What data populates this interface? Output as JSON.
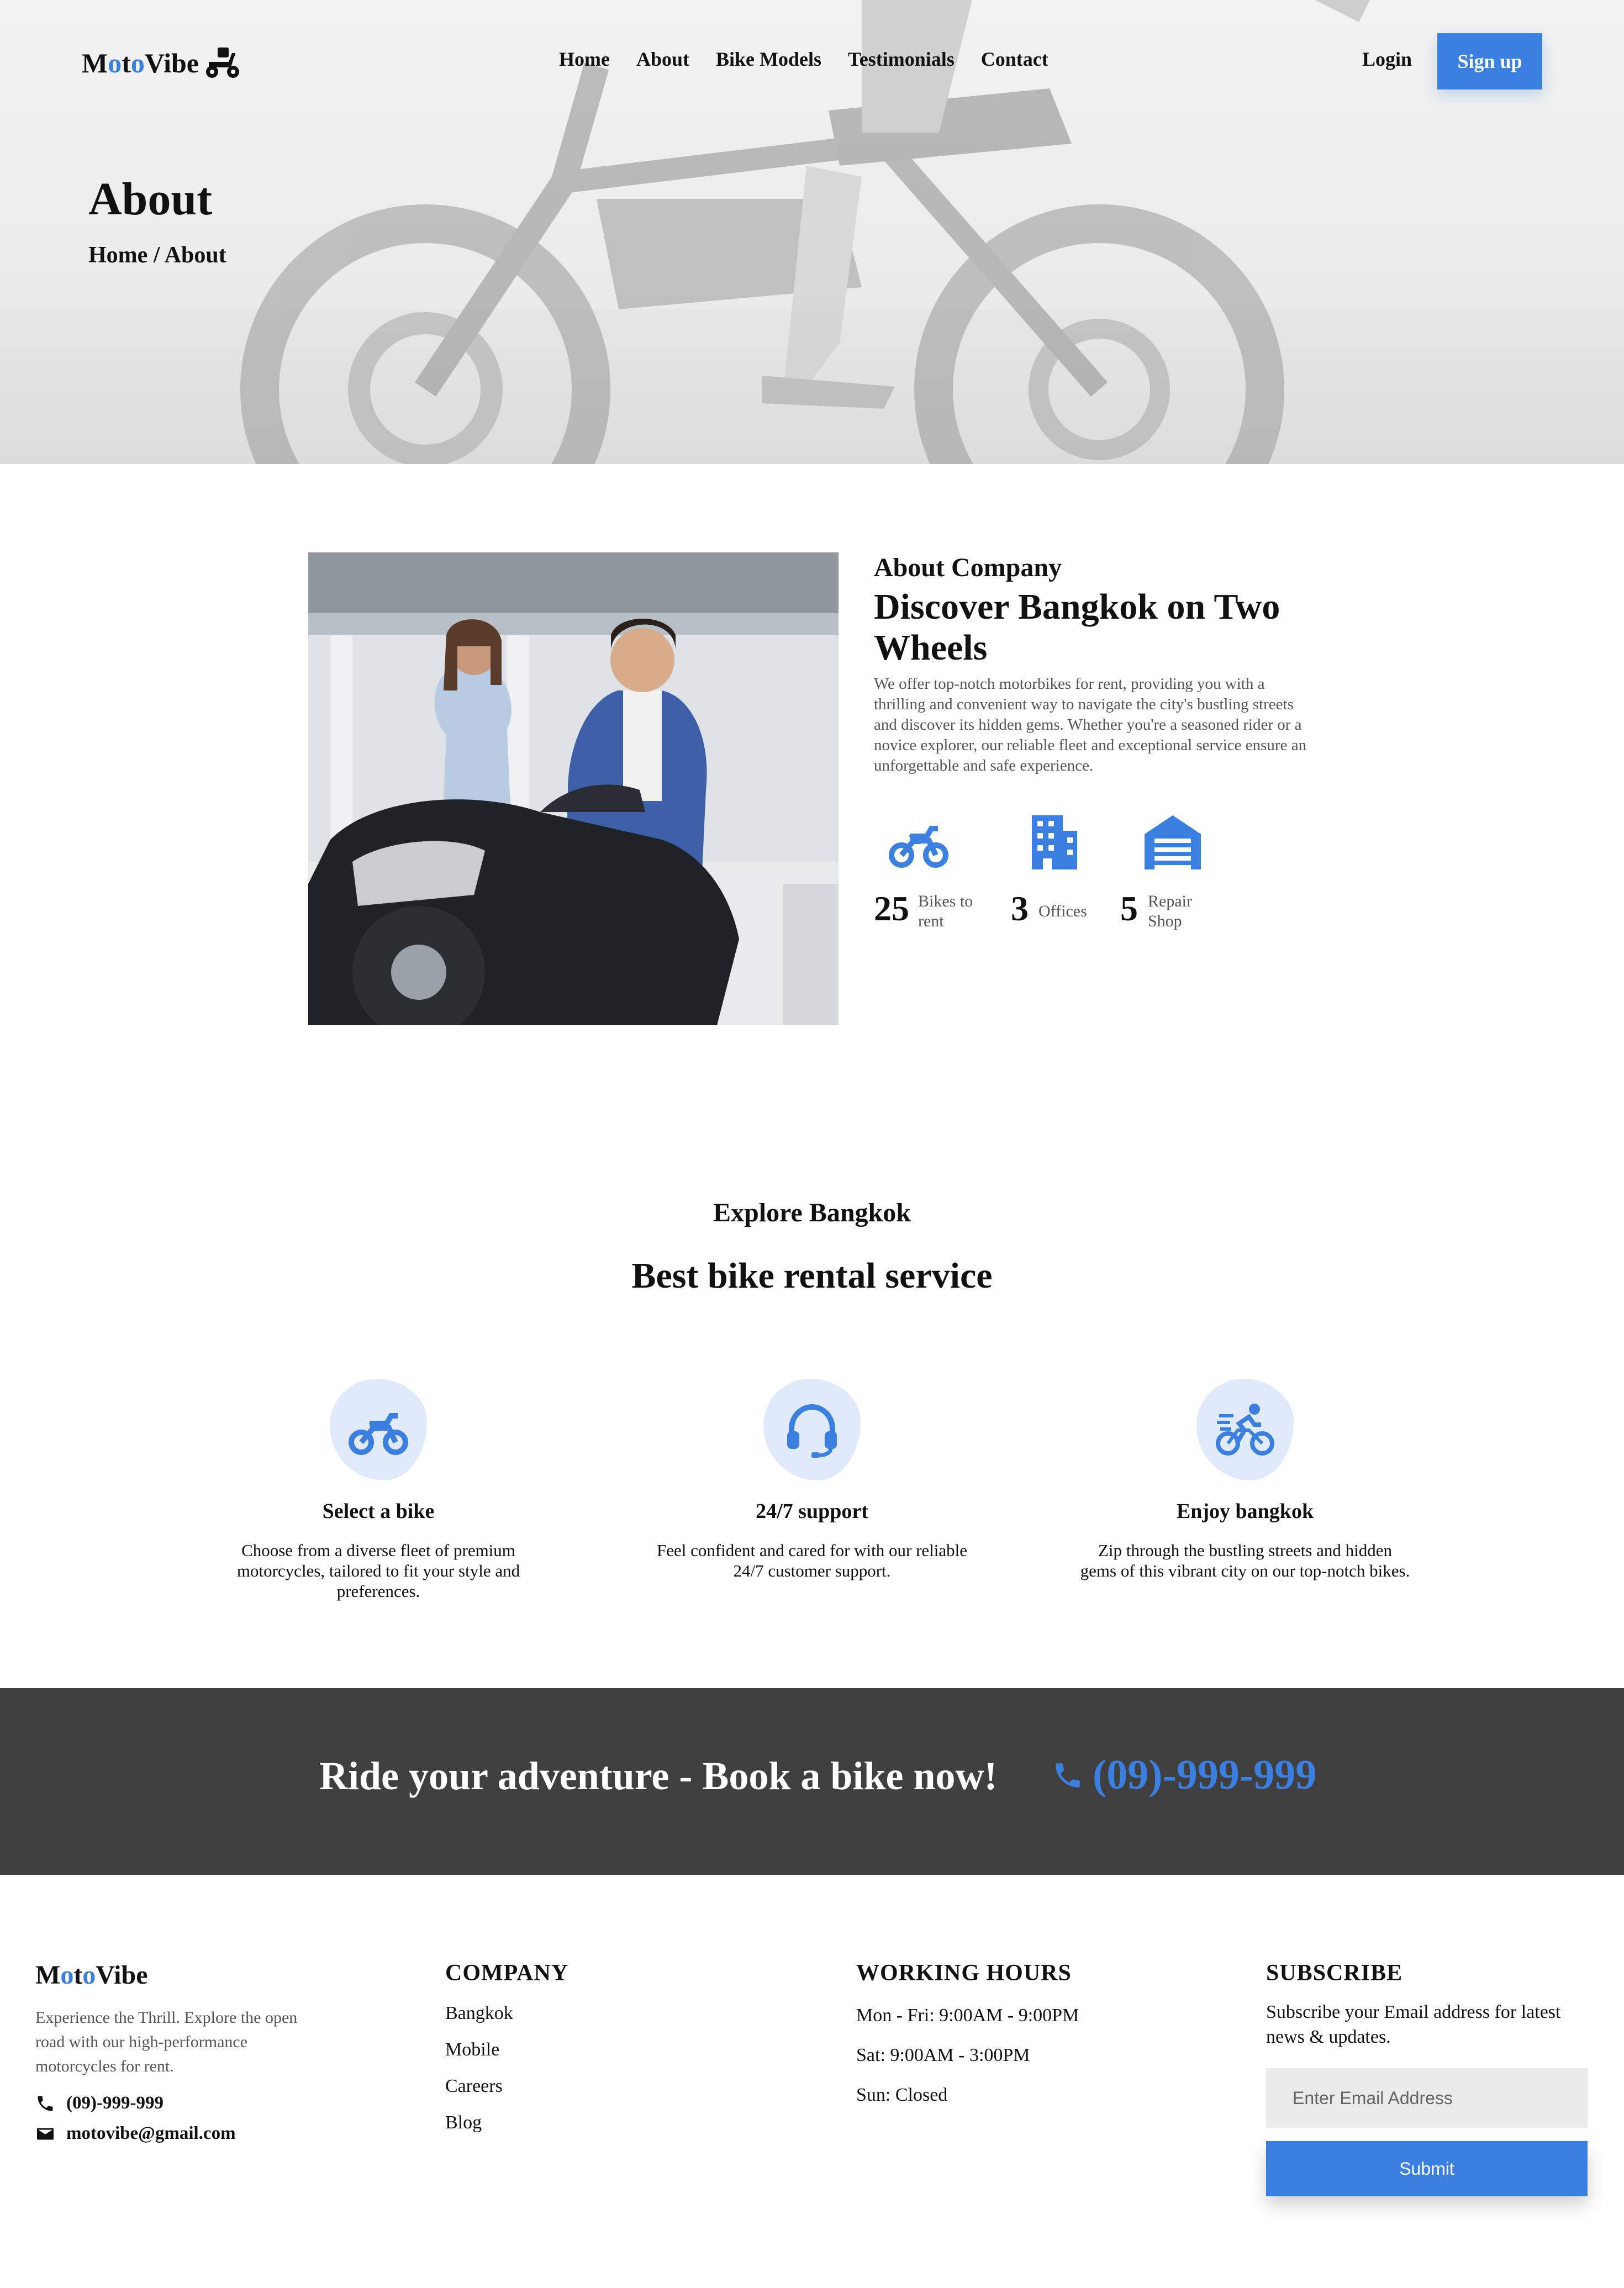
{
  "brand": {
    "prefix": "M",
    "o1": "o",
    "mid": "t",
    "o2": "o",
    "suffix": "Vibe"
  },
  "icons": {
    "logo": "scooter-icon",
    "stat1": "motorbike-icon",
    "stat2": "office-building-icon",
    "stat3": "garage-icon",
    "svc1": "motorbike-icon",
    "svc2": "headset-icon",
    "svc3": "cyclist-icon",
    "phone": "phone-icon",
    "mail": "mail-icon"
  },
  "nav": {
    "links": [
      "Home",
      "About",
      "Bike Models",
      "Testimonials",
      "Contact"
    ],
    "login": "Login",
    "signup": "Sign up"
  },
  "hero": {
    "title": "About",
    "breadcrumb": "Home / About"
  },
  "about": {
    "eyebrow": "About Company",
    "heading": "Discover Bangkok on Two Wheels",
    "body": "We offer top-notch motorbikes for rent, providing you with a thrilling and convenient way to navigate the city's bustling streets and discover its hidden gems. Whether you're a seasoned rider or a novice explorer, our reliable fleet and exceptional service ensure an unforgettable and safe experience.",
    "stats": [
      {
        "value": "25",
        "label": "Bikes to rent"
      },
      {
        "value": "3",
        "label": "Offices"
      },
      {
        "value": "5",
        "label": "Repair Shop"
      }
    ]
  },
  "services": {
    "eyebrow": "Explore Bangkok",
    "heading": "Best bike rental service",
    "items": [
      {
        "title": "Select a bike",
        "desc": "Choose from a diverse fleet of premium motorcycles, tailored to fit your style and preferences."
      },
      {
        "title": "24/7 support",
        "desc": "Feel confident and cared for with our reliable 24/7 customer support."
      },
      {
        "title": "Enjoy bangkok",
        "desc": "Zip through the bustling streets and hidden gems of this vibrant city on our top-notch bikes."
      }
    ]
  },
  "cta": {
    "text": "Ride your adventure - Book a bike now!",
    "phone": "(09)-999-999"
  },
  "footer": {
    "tagline": "Experience the Thrill. Explore the open road with our high-performance motorcycles for rent.",
    "phone": "(09)-999-999",
    "email": "motovibe@gmail.com",
    "company_head": "COMPANY",
    "company_links": [
      "Bangkok",
      "Mobile",
      "Careers",
      "Blog"
    ],
    "hours_head": "WORKING HOURS",
    "hours": [
      "Mon - Fri: 9:00AM - 9:00PM",
      "Sat: 9:00AM - 3:00PM",
      "Sun: Closed"
    ],
    "subscribe_head": "SUBSCRIBE",
    "subscribe_text": "Subscribe your Email address for latest news & updates.",
    "email_placeholder": "Enter Email Address",
    "submit": "Submit"
  },
  "colors": {
    "accent": "#3b7fe0",
    "accent_light": "#e1eafb",
    "band": "#3f3f3f",
    "muted_text": "#555555"
  }
}
